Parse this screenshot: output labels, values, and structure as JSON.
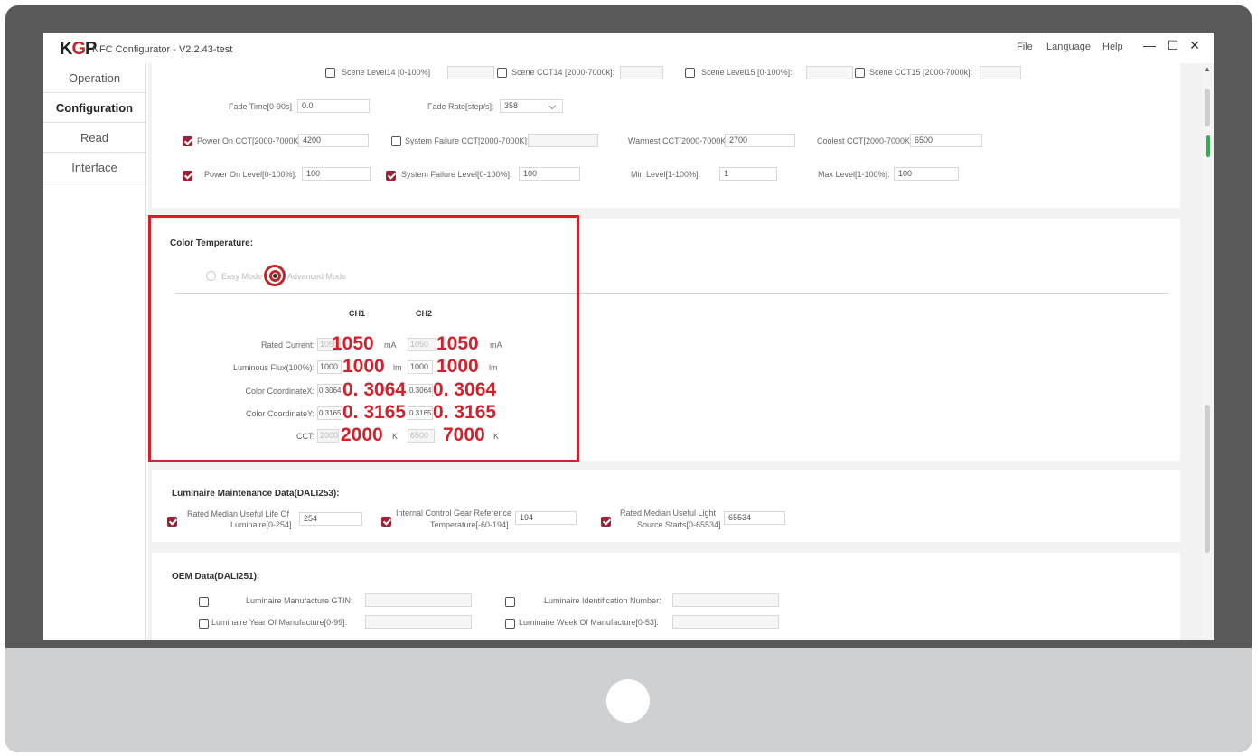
{
  "app": {
    "logo": "KGP",
    "title": "NFC Configurator - V2.2.43-test",
    "menu": [
      "File",
      "Language",
      "Help"
    ],
    "window_controls": [
      "—",
      "☐",
      "✕"
    ]
  },
  "sidebar": {
    "items": [
      {
        "label": "Operation"
      },
      {
        "label": "Configuration"
      },
      {
        "label": "Read"
      },
      {
        "label": "Interface"
      }
    ]
  },
  "scene_row": {
    "items": [
      {
        "label": "Scene Level14 [0-100%]",
        "value": "",
        "checked": false
      },
      {
        "label": "Scene CCT14 [2000-7000k]:",
        "value": "",
        "checked": false
      },
      {
        "label": "Scene Level15 [0-100%]:",
        "value": "",
        "checked": false
      },
      {
        "label": "Scene CCT15 [2000-7000k]:",
        "value": "",
        "checked": false
      }
    ]
  },
  "fade": {
    "time_label": "Fade Time[0-90s]",
    "time_value": "0.0",
    "rate_label": "Fade Rate[step/s]:",
    "rate_value": "358"
  },
  "power_row": {
    "power_on_cct_label": "Power On CCT[2000-7000K]:",
    "power_on_cct_value": "4200",
    "system_failure_cct_label": "System Failure CCT[2000-7000K]:",
    "system_failure_cct_value": "",
    "warmest_label": "Warmest CCT[2000-7000K]:",
    "warmest_value": "2700",
    "coolest_label": "Coolest CCT[2000-7000K]:",
    "coolest_value": "6500"
  },
  "level_row": {
    "power_on_level_label": "Power On Level[0-100%]:",
    "power_on_level_value": "100",
    "system_failure_level_label": "System Failure Level[0-100%]:",
    "system_failure_level_value": "100",
    "min_level_label": "Min Level[1-100%]:",
    "min_level_value": "1",
    "max_level_label": "Max Level[1-100%]:",
    "max_level_value": "100"
  },
  "color_temperature": {
    "title": "Color Temperature:",
    "easy_mode": "Easy Mode",
    "advanced_mode": "Advanced Mode",
    "ch1": "CH1",
    "ch2": "CH2",
    "rows": [
      {
        "label": "Rated Current:",
        "ch1_field": "1050",
        "ch1_big": "1050",
        "ch1_unit": "mA",
        "ch2_field": "1050",
        "ch2_big": "1050",
        "ch2_unit": "mA"
      },
      {
        "label": "Luminous Flux(100%):",
        "ch1_field": "1000",
        "ch1_big": "1000",
        "ch1_unit": "lm",
        "ch2_field": "1000",
        "ch2_big": "1000",
        "ch2_unit": "lm"
      },
      {
        "label": "Color CoordinateX:",
        "ch1_field": "0.3064",
        "ch1_big": "0. 3064",
        "ch1_unit": "",
        "ch2_field": "0.3064",
        "ch2_big": "0. 3064",
        "ch2_unit": ""
      },
      {
        "label": "Color CoordinateY:",
        "ch1_field": "0.3165",
        "ch1_big": "0. 3165",
        "ch1_unit": "",
        "ch2_field": "0.3165",
        "ch2_big": "0. 3165",
        "ch2_unit": ""
      },
      {
        "label": "CCT:",
        "ch1_field": "2000",
        "ch1_big": "2000",
        "ch1_unit": "K",
        "ch2_field": "6500",
        "ch2_big": "7000",
        "ch2_unit": "K"
      }
    ]
  },
  "maintenance": {
    "title": "Luminaire Maintenance Data(DALI253):",
    "life_label_1": "Rated Median Useful Life Of",
    "life_label_2": "Luminaire[0-254]",
    "life_value": "254",
    "gear_label_1": "Internal Control Gear Reference",
    "gear_label_2": "Temperature[-60-194]",
    "gear_value": "194",
    "starts_label_1": "Rated Median Useful Light",
    "starts_label_2": "Source Starts[0-65534]",
    "starts_value": "65534"
  },
  "oem": {
    "title": "OEM Data(DALI251):",
    "gtin_label": "Luminaire Manufacture GTIN:",
    "id_label": "Luminaire Identification Number:",
    "year_label": "Luminaire Year Of Manufacture[0-99]:",
    "week_label": "Luminaire Week Of Manufacture[0-53]:"
  },
  "colors": {
    "accent_red": "#d61f2b",
    "checkbox_red": "#9e2236",
    "scroll_green": "#2db34a",
    "monitor_frame": "#595959",
    "monitor_chin": "#cfd0d2"
  }
}
